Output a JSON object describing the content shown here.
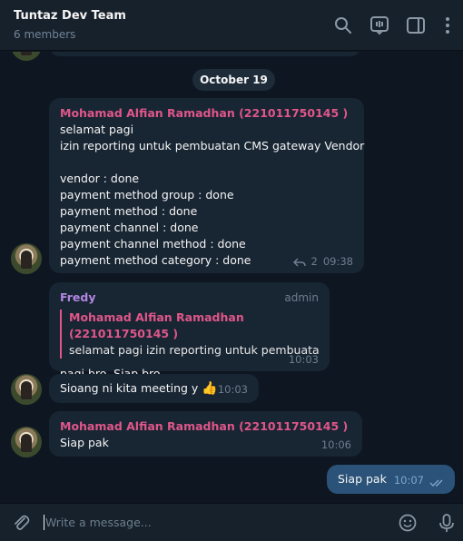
{
  "header": {
    "title": "Tuntaz Dev Team",
    "subtitle": "6 members"
  },
  "date_separator": "October 19",
  "messages": [
    {
      "sender": "Mohamad Alfian Ramadhan (221011750145 )",
      "lines": [
        "selamat pagi",
        "izin reporting untuk pembuatan CMS gateway Vendor",
        "",
        "vendor : done",
        "payment method group : done",
        "payment method : done",
        "payment channel : done",
        "payment channel method : done",
        "payment method category : done"
      ],
      "replies": "2",
      "time": "09:38"
    },
    {
      "sender": "Fredy",
      "role": "admin",
      "quote_sender": "Mohamad Alfian Ramadhan (221011750145 )",
      "quote_text": "selamat pagi  izin reporting untuk pembuata...",
      "text": "pagi bro. Siap bro",
      "time": "10:03"
    },
    {
      "text": "Sioang ni kita meeting y",
      "emoji": "👍",
      "time": "10:03"
    },
    {
      "sender": "Mohamad Alfian Ramadhan (221011750145 )",
      "text": "Siap pak",
      "time": "10:06"
    },
    {
      "text": "Siap pak",
      "time": "10:07",
      "status": "read"
    }
  ],
  "composer": {
    "placeholder": "Write a message..."
  },
  "colors": {
    "background": "#0e1621",
    "panel": "#17212b",
    "incoming_bubble": "#182533",
    "outgoing_bubble": "#2b5278",
    "sender_pink": "#e0568a",
    "sender_purple": "#b186e0"
  }
}
